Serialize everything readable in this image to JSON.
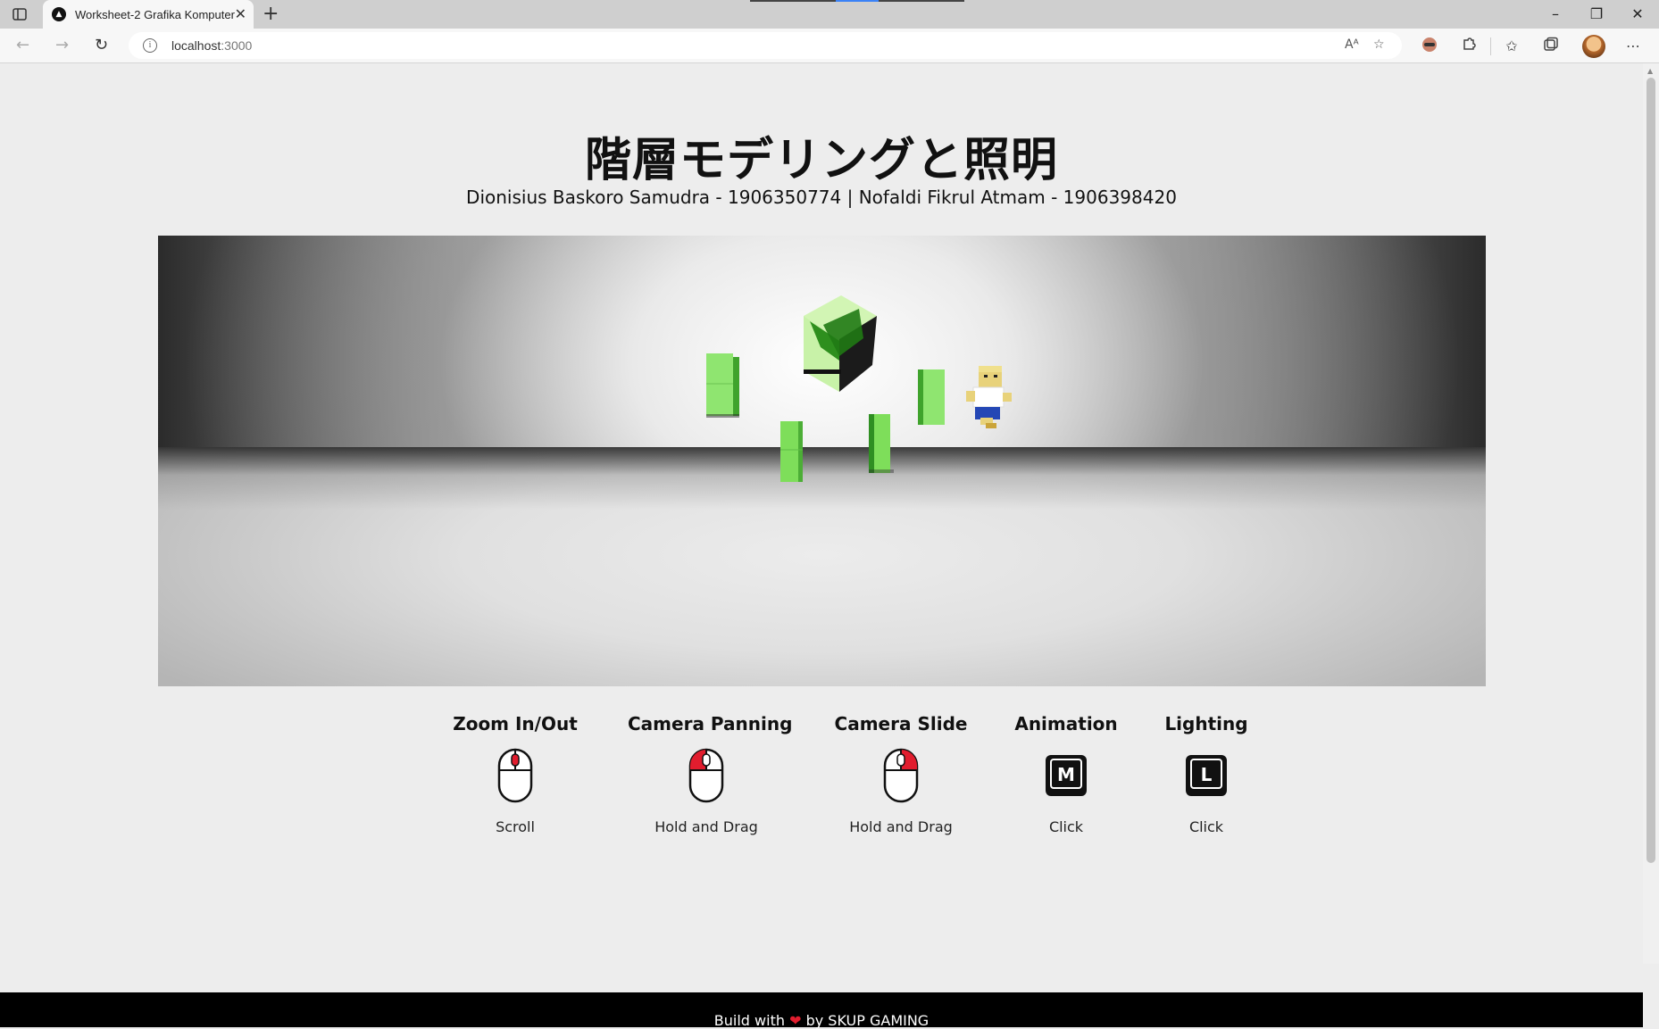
{
  "browser": {
    "tab_title": "Worksheet-2 Grafika Komputer",
    "url_host": "localhost",
    "url_port": ":3000",
    "read_aloud_label": "Aᴬ"
  },
  "page": {
    "title": "階層モデリングと照明",
    "subtitle": "Dionisius Baskoro Samudra - 1906350774 | Nofaldi Fikrul Atmam - 1906398420"
  },
  "controls": [
    {
      "title": "Zoom In/Out",
      "icon": "mouse-scroll-icon",
      "action": "Scroll"
    },
    {
      "title": "Camera Panning",
      "icon": "mouse-left-click-icon",
      "action": "Hold and Drag"
    },
    {
      "title": "Camera Slide",
      "icon": "mouse-right-click-icon",
      "action": "Hold and Drag"
    },
    {
      "title": "Animation",
      "icon": "key-m-icon",
      "key": "M",
      "action": "Click"
    },
    {
      "title": "Lighting",
      "icon": "key-l-icon",
      "key": "L",
      "action": "Click"
    }
  ],
  "footer": {
    "prefix": "Build with",
    "suffix": "by SKUP GAMING"
  },
  "colors": {
    "accent_red": "#e11d2e",
    "cube_green": "#7ede5a",
    "footer_bg": "#000000"
  }
}
